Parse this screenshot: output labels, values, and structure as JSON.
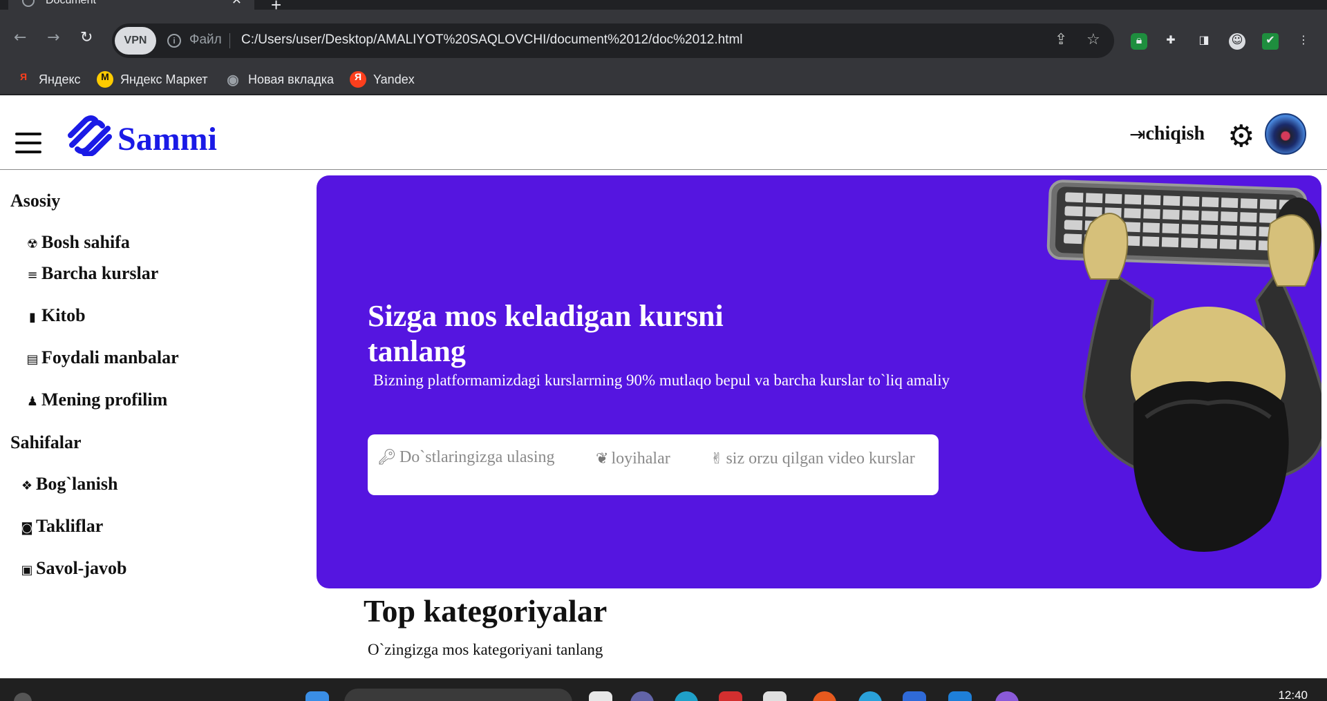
{
  "browser": {
    "tab_title": "Document",
    "tab_close": "✕",
    "new_tab": "+",
    "vpn_label": "VPN",
    "file_label": "Файл",
    "url": "C:/Users/user/Desktop/AMALIYOT%20SAQLOVCHI/document%2012/doc%2012.html",
    "bookmarks": [
      {
        "label": "Яндекс",
        "icon": "yandex-icon",
        "icon_text": "Я",
        "color": "#fc3f1d"
      },
      {
        "label": "Яндекс Маркет",
        "icon": "yandex-market-icon",
        "icon_text": "M",
        "color": "#ffcc00"
      },
      {
        "label": "Новая вкладка",
        "icon": "globe-icon",
        "icon_text": "◉",
        "color": "#9aa0a6"
      },
      {
        "label": "Yandex",
        "icon": "yandex-icon",
        "icon_text": "Я",
        "color": "#fc3f1d"
      }
    ]
  },
  "header": {
    "brand": "Sammi",
    "logout_label": "chiqish",
    "logout_icon": "logout-icon",
    "settings_icon": "gear-icon"
  },
  "sidebar": {
    "section1": "Asosiy",
    "section2": "Sahifalar",
    "items1": [
      {
        "label": "Bosh sahifa",
        "icon": "☢"
      },
      {
        "label": "Barcha kurslar",
        "icon": "≡"
      },
      {
        "label": "Kitob",
        "icon": "▮"
      },
      {
        "label": "Foydali manbalar",
        "icon": "▤"
      },
      {
        "label": "Mening profilim",
        "icon": "♟"
      }
    ],
    "items2": [
      {
        "label": "Bog`lanish",
        "icon": "❖"
      },
      {
        "label": "Takliflar",
        "icon": "◙"
      },
      {
        "label": "Savol-javob",
        "icon": "▣"
      }
    ]
  },
  "hero": {
    "title": "Sizga mos keladigan kursni tanlang",
    "subtitle": "Bizning platformamizdagi kurslarrning 90% mutlaqo bepul va barcha kurslar to`liq amaliy",
    "features": [
      {
        "label": "Do`stlaringizga ulasing",
        "icon": "key-icon"
      },
      {
        "label": "loyihalar",
        "icon": "leaf-icon"
      },
      {
        "label": "siz orzu qilgan video kurslar",
        "icon": "peace-hand-icon"
      }
    ],
    "color": "#5515e0"
  },
  "categories": {
    "title": "Top kategoriyalar",
    "subtitle": "O`zingizga mos kategoriyani tanlang"
  },
  "taskbar": {
    "time": "12:40"
  }
}
